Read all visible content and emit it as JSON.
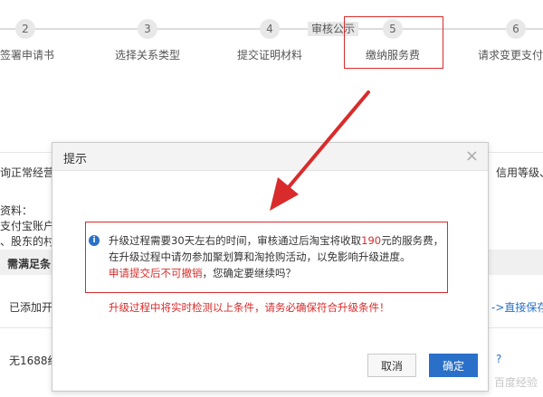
{
  "stepper": {
    "steps": [
      {
        "number": "2",
        "label": "签署申请书"
      },
      {
        "number": "3",
        "label": "选择关系类型"
      },
      {
        "number": "4",
        "label": "提交证明材料"
      },
      {
        "number": "5",
        "label": "缴纳服务费"
      },
      {
        "number": "6",
        "label": "请求变更支付"
      }
    ],
    "audit_tag": "审核公示"
  },
  "background": {
    "text_left_1": "询正常经营",
    "text_right_1": "信用等级、",
    "text_left_2": "资料：",
    "text_left_3": "支付宝账户",
    "text_left_4": "、股东的村",
    "table_header": "需满足条",
    "row1_left": "已添加开",
    "row1_right": "->直接保存",
    "row2_left": "无1688经",
    "row2_right": "?"
  },
  "dialog": {
    "title": "提示",
    "close": "×",
    "message_part1": "升级过程需要30天左右的时间，审核通过后淘宝将收取",
    "message_amount": "190",
    "message_part2": "元的服务费，在升级过程中请勿参加聚划算和淘抢购活动，以免影响升级进度。",
    "message_warning": "申请提交后不可撤销",
    "message_part3": "，您确定要继续吗？",
    "condition_warning": "升级过程中将实时检测以上条件，请务必确保符合升级条件！",
    "cancel_label": "取消",
    "ok_label": "确定"
  },
  "colors": {
    "accent_red": "#d92b2b",
    "primary_blue": "#2a70c8"
  },
  "watermark": "百度经验"
}
